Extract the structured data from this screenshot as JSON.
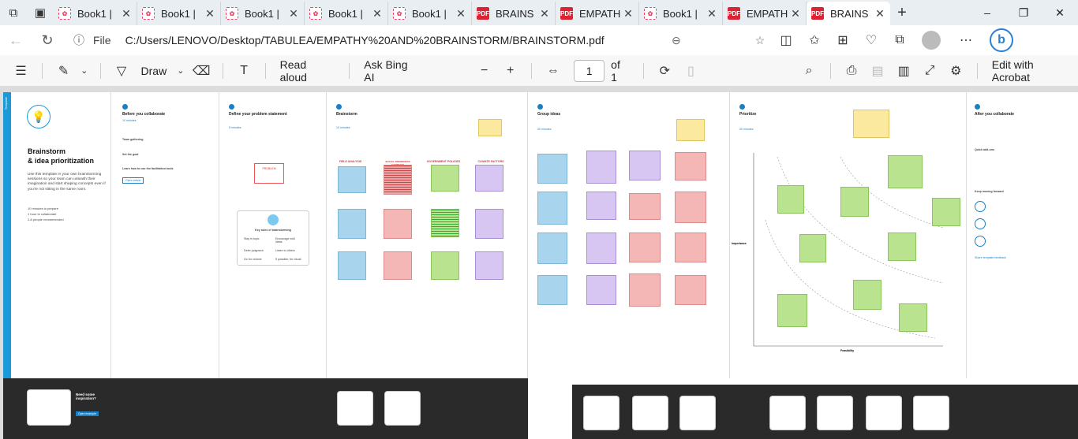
{
  "tabs": [
    {
      "title": "Book1 |",
      "kind": "sheet",
      "active": false
    },
    {
      "title": "Book1 |",
      "kind": "sheet",
      "active": false
    },
    {
      "title": "Book1 |",
      "kind": "sheet",
      "active": false
    },
    {
      "title": "Book1 |",
      "kind": "sheet",
      "active": false
    },
    {
      "title": "Book1 |",
      "kind": "sheet",
      "active": false
    },
    {
      "title": "BRAINS",
      "kind": "pdf",
      "active": false
    },
    {
      "title": "EMPATH",
      "kind": "pdf",
      "active": false
    },
    {
      "title": "Book1 |",
      "kind": "sheet",
      "active": false
    },
    {
      "title": "EMPATH",
      "kind": "pdf",
      "active": false
    },
    {
      "title": "BRAINS",
      "kind": "pdf",
      "active": true
    }
  ],
  "address": {
    "file_label": "File",
    "url": "C:/Users/LENOVO/Desktop/TABULEA/EMPATHY%20AND%20BRAINSTORM/BRAINSTORM.pdf"
  },
  "toolbar": {
    "draw": "Draw",
    "read_aloud": "Read aloud",
    "ask_bing": "Ask Bing AI",
    "page": "1",
    "of_pages": "of 1",
    "edit_acrobat": "Edit with Acrobat"
  },
  "board": {
    "intro": {
      "tag": "Template",
      "title": "Brainstorm",
      "title2": "& idea prioritization",
      "desc": "Use this template in your own brainstorming sessions so your team can unleash their imagination and start shaping concepts even if you're not sitting in the same room.",
      "stat1": "10 minutes to prepare",
      "stat2": "1 hour to collaborate",
      "stat3": "2-8 people recommended"
    },
    "before": {
      "title": "Before you collaborate",
      "time": "10 minutes",
      "a": "Team gathering",
      "b": "Set the goal",
      "c": "Learn how to use the facilitation tools",
      "link": "Open article"
    },
    "define": {
      "title": "Define your problem statement",
      "time": "5 minutes",
      "problem": "PROBLEM",
      "rules": "Key rules of brainstorming",
      "r1": "Stay in topic",
      "r2": "Encourage wild ideas",
      "r3": "Defer judgment",
      "r4": "Listen to others",
      "r5": "Go for volume",
      "r6": "If possible, be visual"
    },
    "brainstorm": {
      "title": "Brainstorm",
      "time": "10 minutes",
      "h1": "FIELD ANALYSIS",
      "h2": "SOCIAL AWARENESS CAMPAIGN",
      "h3": "GOVERNMENT POLICIES",
      "h4": "CLIMATE FACTORS"
    },
    "group": {
      "title": "Group ideas",
      "time": "20 minutes"
    },
    "prioritize": {
      "title": "Prioritize",
      "time": "20 minutes",
      "ylabel": "Importance",
      "xlabel": "Feasibility"
    },
    "after": {
      "title": "After you collaborate",
      "s1": "Quick add-ons",
      "s2": "Keep moving forward",
      "link": "Share template feedback"
    },
    "footer": {
      "title": "Need some inspiration?",
      "link": "Open example"
    }
  }
}
